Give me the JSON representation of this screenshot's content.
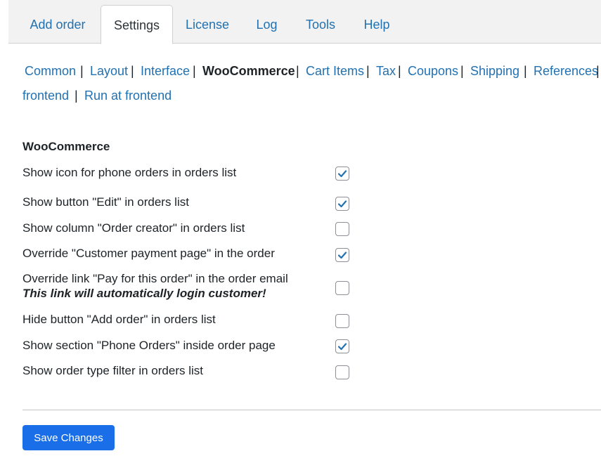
{
  "tabs": [
    {
      "label": "Add order",
      "active": false
    },
    {
      "label": "Settings",
      "active": true
    },
    {
      "label": "License",
      "active": false
    },
    {
      "label": "Log",
      "active": false
    },
    {
      "label": "Tools",
      "active": false
    },
    {
      "label": "Help",
      "active": false
    }
  ],
  "subnav": {
    "items": [
      "Common",
      "Layout",
      "Interface",
      "WooCommerce",
      "Cart Items",
      "Tax",
      "Coupons",
      "Shipping",
      "References",
      "frontend",
      "Run at frontend"
    ],
    "current": "WooCommerce",
    "separator": "|"
  },
  "section": {
    "title": "WooCommerce",
    "settings": [
      {
        "label": "Show icon for phone orders in orders list",
        "note": "",
        "checked": true
      },
      {
        "label": "Show button \"Edit\" in orders list",
        "note": "",
        "checked": true
      },
      {
        "label": "Show column \"Order creator\" in orders list",
        "note": "",
        "checked": false
      },
      {
        "label": "Override \"Customer payment page\" in the order",
        "note": "",
        "checked": true
      },
      {
        "label": "Override link \"Pay for this order\" in the order email",
        "note": "This link will automatically login customer!",
        "checked": false
      },
      {
        "label": "Hide button \"Add order\" in orders list",
        "note": "",
        "checked": false
      },
      {
        "label": "Show section \"Phone Orders\" inside order page",
        "note": "",
        "checked": true
      },
      {
        "label": "Show order type filter in orders list",
        "note": "",
        "checked": false
      }
    ]
  },
  "footer": {
    "save_label": "Save Changes"
  },
  "colors": {
    "link": "#2271b1",
    "primary_button": "#1a6fe8",
    "checkmark": "#2271b1"
  }
}
